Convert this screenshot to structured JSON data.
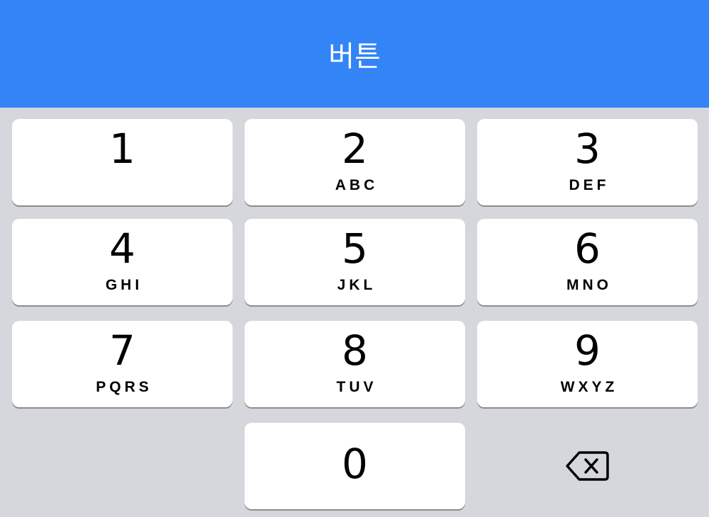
{
  "header": {
    "button_label": "버튼",
    "background_color": "#3384f6"
  },
  "keypad": {
    "background_color": "#d5d7dc",
    "keys": [
      {
        "digit": "1",
        "letters": ""
      },
      {
        "digit": "2",
        "letters": "ABC"
      },
      {
        "digit": "3",
        "letters": "DEF"
      },
      {
        "digit": "4",
        "letters": "GHI"
      },
      {
        "digit": "5",
        "letters": "JKL"
      },
      {
        "digit": "6",
        "letters": "MNO"
      },
      {
        "digit": "7",
        "letters": "PQRS"
      },
      {
        "digit": "8",
        "letters": "TUV"
      },
      {
        "digit": "9",
        "letters": "WXYZ"
      },
      {
        "digit": "0",
        "letters": ""
      }
    ],
    "backspace_icon": "backspace-icon"
  }
}
